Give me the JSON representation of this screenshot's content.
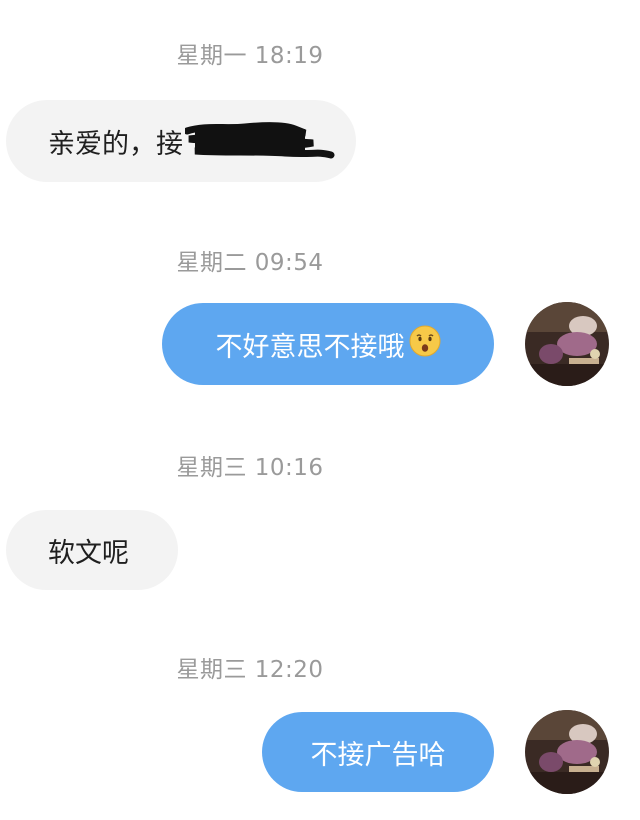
{
  "messages": [
    {
      "timestamp": "星期一 18:19",
      "direction": "incoming",
      "text": "亲爱的，接",
      "redacted": true
    },
    {
      "timestamp": "星期二 09:54",
      "direction": "outgoing",
      "text": "不好意思不接哦",
      "emoji": "hushed-face-icon"
    },
    {
      "timestamp": "星期三 10:16",
      "direction": "incoming",
      "text": "软文呢"
    },
    {
      "timestamp": "星期三 12:20",
      "direction": "outgoing",
      "text": "不接广告哈"
    }
  ],
  "colors": {
    "outgoing_bubble": "#5ea7f0",
    "incoming_bubble": "#f3f3f3",
    "timestamp": "#9a9a9a"
  }
}
